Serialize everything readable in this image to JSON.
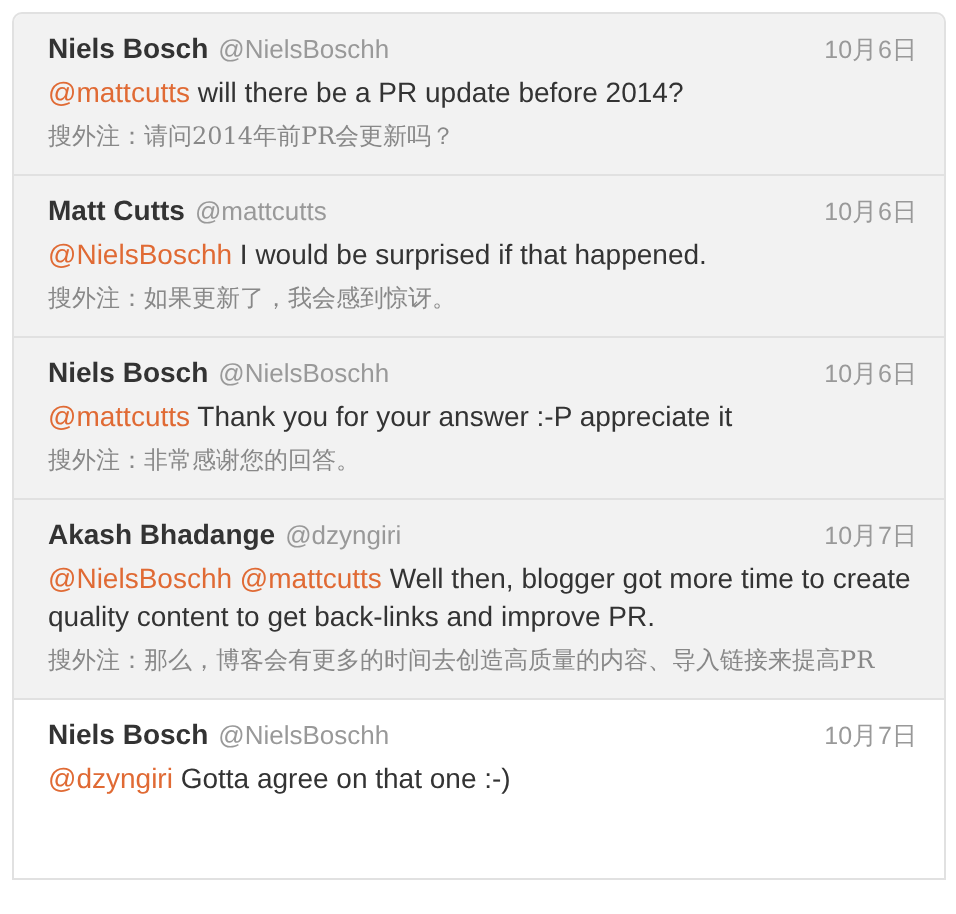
{
  "tweets": [
    {
      "name": "Niels Bosch",
      "handle": "@NielsBoschh",
      "date": "10月6日",
      "mentions": [
        "@mattcutts"
      ],
      "text": "will there be a PR update before 2014?",
      "note": "搜外注：请问2014年前PR会更新吗？",
      "selected": false
    },
    {
      "name": "Matt Cutts",
      "handle": "@mattcutts",
      "date": "10月6日",
      "mentions": [
        "@NielsBoschh"
      ],
      "text": "I would be surprised if that happened.",
      "note": "搜外注：如果更新了，我会感到惊讶。",
      "selected": false
    },
    {
      "name": "Niels Bosch",
      "handle": "@NielsBoschh",
      "date": "10月6日",
      "mentions": [
        "@mattcutts"
      ],
      "text": "Thank you for your answer :-P appreciate it",
      "note": "搜外注：非常感谢您的回答。",
      "selected": false
    },
    {
      "name": "Akash Bhadange",
      "handle": "@dzyngiri",
      "date": "10月7日",
      "mentions": [
        "@NielsBoschh",
        "@mattcutts"
      ],
      "text": "Well then, blogger got more time to create quality content to get back-links and improve PR.",
      "note": "搜外注：那么，博客会有更多的时间去创造高质量的内容、导入链接来提高PR",
      "selected": false
    },
    {
      "name": "Niels Bosch",
      "handle": "@NielsBoschh",
      "date": "10月7日",
      "mentions": [
        "@dzyngiri"
      ],
      "text": "Gotta agree on that one :-)",
      "selected": true
    }
  ]
}
